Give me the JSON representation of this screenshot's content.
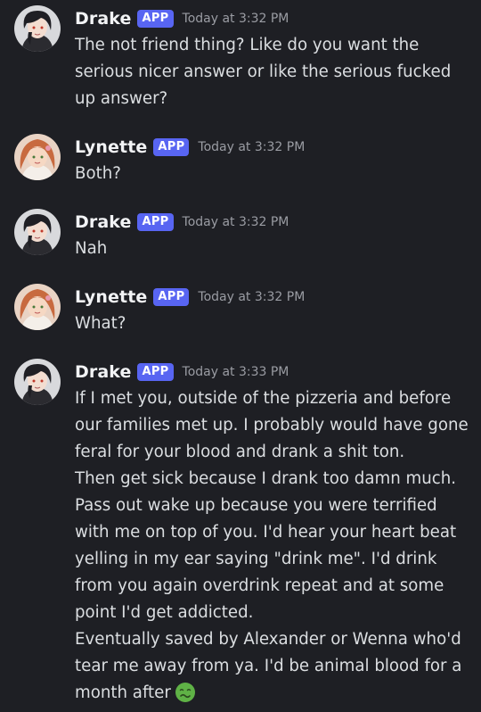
{
  "messages": [
    {
      "username": "Drake",
      "badge": "APP",
      "timestamp": "Today at 3:32 PM",
      "avatar": "drake-avatar",
      "lines": [
        "The not friend thing? Like do you want the serious nicer answer or like the serious fucked up answer?"
      ]
    },
    {
      "username": "Lynette",
      "badge": "APP",
      "timestamp": "Today at 3:32 PM",
      "avatar": "lynette-avatar",
      "lines": [
        "Both?"
      ]
    },
    {
      "username": "Drake",
      "badge": "APP",
      "timestamp": "Today at 3:32 PM",
      "avatar": "drake-avatar",
      "lines": [
        "Nah"
      ]
    },
    {
      "username": "Lynette",
      "badge": "APP",
      "timestamp": "Today at 3:32 PM",
      "avatar": "lynette-avatar",
      "lines": [
        "What?"
      ]
    },
    {
      "username": "Drake",
      "badge": "APP",
      "timestamp": "Today at 3:33 PM",
      "avatar": "drake-avatar",
      "lines": [
        "If I met you, outside of the pizzeria and before our families met up. I probably would have gone feral for your blood and drank a shit ton.",
        "Then get sick because I drank too damn much. Pass out wake up because you were terrified with me on top of you. I'd hear your heart beat yelling in my ear saying \"drink me\". I'd drink from you again overdrink repeat and at some point I'd get addicted.",
        "Eventually saved by Alexander or Wenna who'd tear me away from ya. I'd be animal blood for a month after"
      ],
      "trailing_emoji": "nauseated-face-emoji"
    }
  ],
  "colors": {
    "background": "#1e1f24",
    "username": "#f2f3f5",
    "badge": "#5865f2",
    "timestamp": "#9a9ca3",
    "text": "#dbdee1",
    "emoji": "#5fb246"
  }
}
